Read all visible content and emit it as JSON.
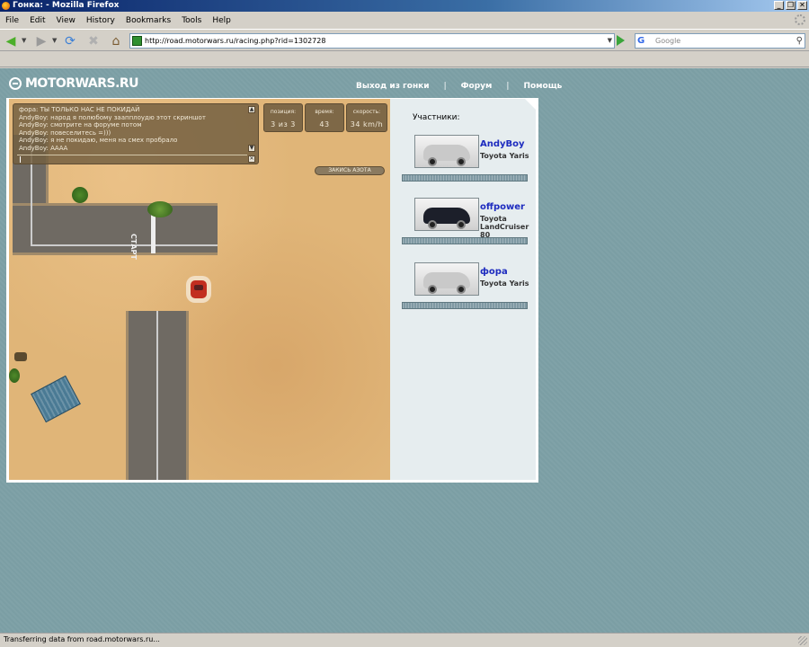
{
  "window": {
    "title": "Гонка: - Mozilla Firefox",
    "controls": [
      "_",
      "❐",
      "✕"
    ]
  },
  "menu": [
    "File",
    "Edit",
    "View",
    "History",
    "Bookmarks",
    "Tools",
    "Help"
  ],
  "nav": {
    "url": "http://road.motorwars.ru/racing.php?rid=1302728",
    "search_placeholder": "Google",
    "icons": [
      "back-icon",
      "forward-icon",
      "reload-icon",
      "stop-icon",
      "home-icon"
    ]
  },
  "site": {
    "logo": "MOTORWARS.RU",
    "links": [
      "Выход из гонки",
      "Форум",
      "Помощь"
    ],
    "separator": "|"
  },
  "game": {
    "chat": [
      {
        "nick": "фора",
        "text": "ТЫ ТОЛЬКО НАС НЕ ПОКИДАЙ"
      },
      {
        "nick": "AndyBoy",
        "text": "народ я полюбому заапплоудю этот скриншот"
      },
      {
        "nick": "AndyBoy",
        "text": "смотрите на форуме потом"
      },
      {
        "nick": "AndyBoy",
        "text": "повеселитесь =)))"
      },
      {
        "nick": "AndyBoy",
        "text": "я не покидаю, меня на смех пробрало"
      },
      {
        "nick": "AndyBoy",
        "text": "АААА"
      }
    ],
    "stats": {
      "position_label": "позиция:",
      "position_value": "3 из 3",
      "time_label": "время:",
      "time_value": "43",
      "speed_label": "скорость:",
      "speed_value": "34 km/h"
    },
    "nitro_button": "ЗАКИСЬ АЗОТА",
    "start_label": "СТАРТ"
  },
  "participants": {
    "title": "Участники:",
    "players": [
      {
        "name": "AndyBoy",
        "car": "Toyota Yaris",
        "car_color": "#c9c9c9"
      },
      {
        "name": "offpower",
        "car": "Toyota LandCruiser 80",
        "car_color": "#1c1f2a"
      },
      {
        "name": "фора",
        "car": "Toyota Yaris",
        "car_color": "#c9c9c9"
      }
    ]
  },
  "status": {
    "text": "Transferring data from road.motorwars.ru..."
  }
}
